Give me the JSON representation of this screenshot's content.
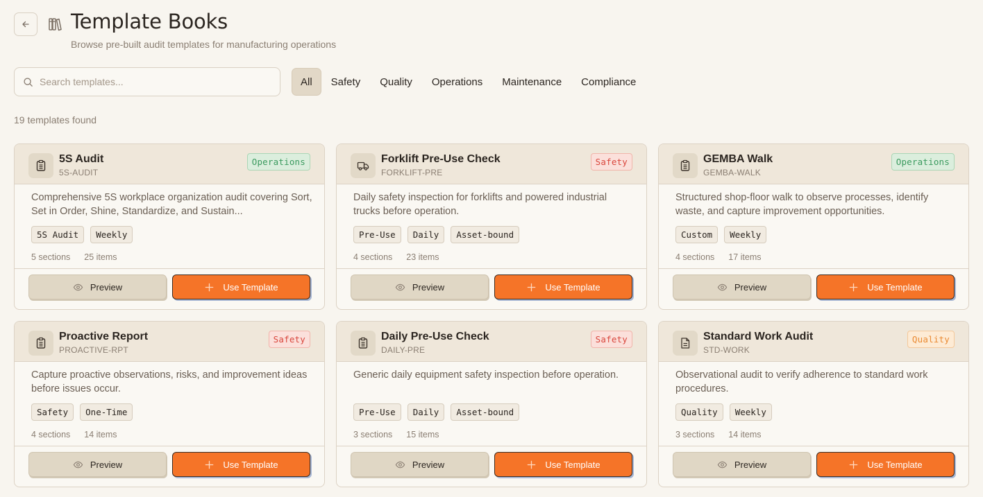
{
  "header": {
    "title": "Template Books",
    "subtitle": "Browse pre-built audit templates for manufacturing operations",
    "back_icon": "arrow-left-icon",
    "book_icon": "books-icon"
  },
  "search": {
    "placeholder": "Search templates..."
  },
  "filters": [
    {
      "label": "All",
      "active": true
    },
    {
      "label": "Safety",
      "active": false
    },
    {
      "label": "Quality",
      "active": false
    },
    {
      "label": "Operations",
      "active": false
    },
    {
      "label": "Maintenance",
      "active": false
    },
    {
      "label": "Compliance",
      "active": false
    }
  ],
  "count_text": "19 templates found",
  "buttons": {
    "preview": "Preview",
    "use": "Use Template"
  },
  "colors": {
    "accent": "#f57428",
    "operations": "#3a9a5e",
    "safety": "#d9463c",
    "quality": "#ea8a32"
  },
  "cards": [
    {
      "title": "5S Audit",
      "code": "5S-AUDIT",
      "category": "Operations",
      "icon": "clipboard-icon",
      "description": "Comprehensive 5S workplace organization audit covering Sort, Set in Order, Shine, Standardize, and Sustain...",
      "tags": [
        "5S Audit",
        "Weekly"
      ],
      "sections": "5 sections",
      "items": "25 items"
    },
    {
      "title": "Forklift Pre-Use Check",
      "code": "FORKLIFT-PRE",
      "category": "Safety",
      "icon": "truck-icon",
      "description": "Daily safety inspection for forklifts and powered industrial trucks before operation.",
      "tags": [
        "Pre-Use",
        "Daily",
        "Asset-bound"
      ],
      "sections": "4 sections",
      "items": "23 items"
    },
    {
      "title": "GEMBA Walk",
      "code": "GEMBA-WALK",
      "category": "Operations",
      "icon": "clipboard-icon",
      "description": "Structured shop-floor walk to observe processes, identify waste, and capture improvement opportunities.",
      "tags": [
        "Custom",
        "Weekly"
      ],
      "sections": "4 sections",
      "items": "17 items"
    },
    {
      "title": "Proactive Report",
      "code": "PROACTIVE-RPT",
      "category": "Safety",
      "icon": "clipboard-icon",
      "description": "Capture proactive observations, risks, and improvement ideas before issues occur.",
      "tags": [
        "Safety",
        "One-Time"
      ],
      "sections": "4 sections",
      "items": "14 items"
    },
    {
      "title": "Daily Pre-Use Check",
      "code": "DAILY-PRE",
      "category": "Safety",
      "icon": "clipboard-icon",
      "description": "Generic daily equipment safety inspection before operation.",
      "tags": [
        "Pre-Use",
        "Daily",
        "Asset-bound"
      ],
      "sections": "3 sections",
      "items": "15 items"
    },
    {
      "title": "Standard Work Audit",
      "code": "STD-WORK",
      "category": "Quality",
      "icon": "document-icon",
      "description": "Observational audit to verify adherence to standard work procedures.",
      "tags": [
        "Quality",
        "Weekly"
      ],
      "sections": "3 sections",
      "items": "14 items"
    }
  ]
}
